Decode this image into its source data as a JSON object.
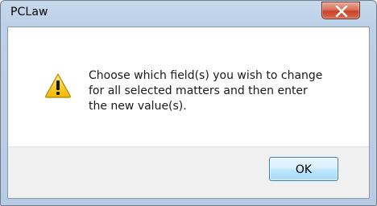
{
  "window": {
    "title": "PCLaw",
    "close_icon": "close-icon"
  },
  "dialog": {
    "icon": "warning-icon",
    "message_lines": [
      "Choose which field(s) you wish to change",
      "for all selected matters and then enter",
      "the new value(s)."
    ],
    "ok_label": "OK"
  },
  "colors": {
    "warning_yellow": "#f5c400",
    "close_red": "#c7432a",
    "ok_border": "#3c7fb1"
  }
}
